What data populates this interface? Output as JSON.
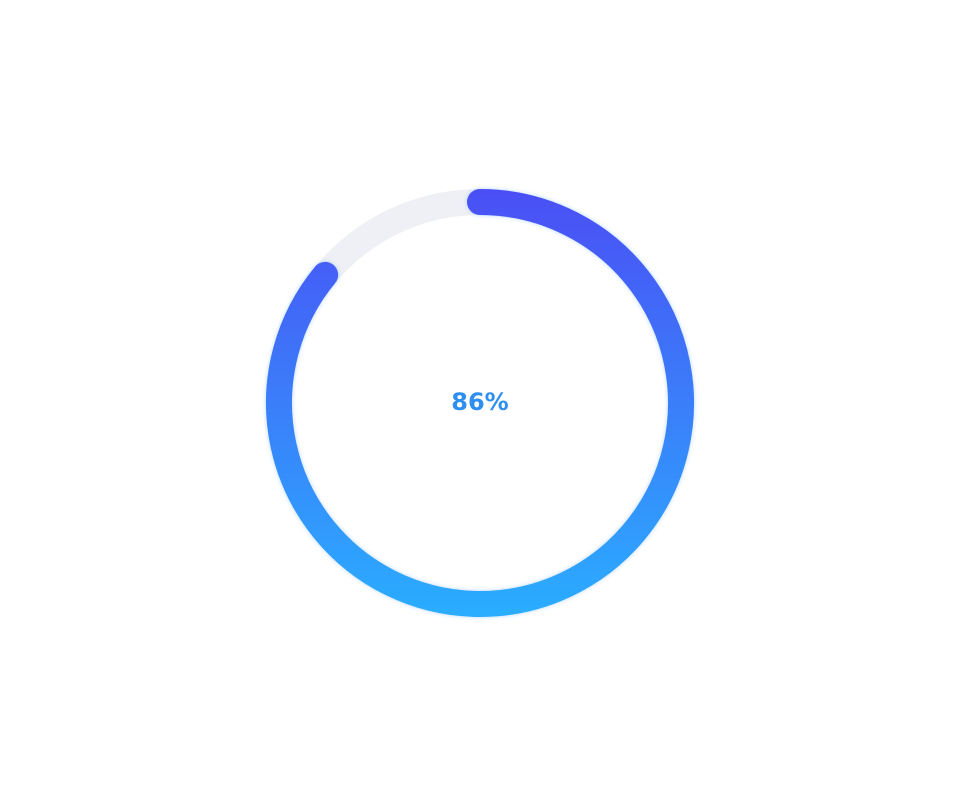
{
  "progress": {
    "value": 0.86,
    "label": "86%",
    "colors": {
      "track": "#eef0f5",
      "gradient_top": "#4a4ff5",
      "gradient_bottom": "#2aaeff",
      "label": "#2f8ff0"
    }
  }
}
